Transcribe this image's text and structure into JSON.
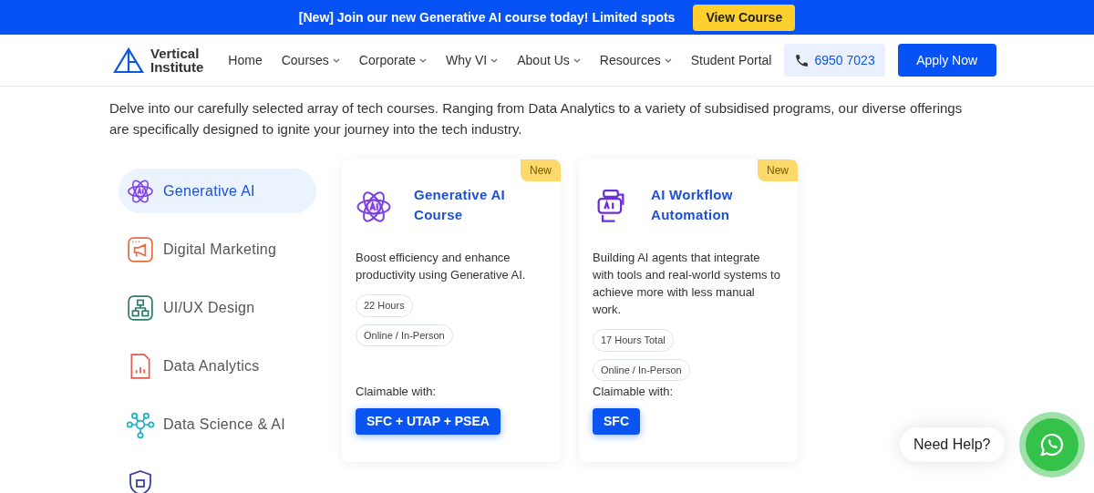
{
  "banner": {
    "text": "[New] Join our new Generative AI course today! Limited spots",
    "button": "View Course"
  },
  "nav": {
    "logo": [
      "Vertical",
      "Institute"
    ],
    "items": [
      {
        "label": "Home",
        "dropdown": false
      },
      {
        "label": "Courses",
        "dropdown": true
      },
      {
        "label": "Corporate",
        "dropdown": true
      },
      {
        "label": "Why VI",
        "dropdown": true
      },
      {
        "label": "About Us",
        "dropdown": true
      },
      {
        "label": "Resources",
        "dropdown": true
      },
      {
        "label": "Student Portal",
        "dropdown": false
      }
    ],
    "phone": "6950 7023",
    "cta": "Apply Now"
  },
  "intro": "Delve into our carefully selected array of tech courses. Ranging from Data Analytics to a variety of subsidised programs, our diverse offerings are specifically designed to ignite your journey into the tech industry.",
  "sidebar": {
    "items": [
      {
        "label": "Generative AI",
        "kind": "ai",
        "selected": true
      },
      {
        "label": "Digital Marketing",
        "kind": "marketing",
        "selected": false
      },
      {
        "label": "UI/UX Design",
        "kind": "design",
        "selected": false
      },
      {
        "label": "Data Analytics",
        "kind": "analytics",
        "selected": false
      },
      {
        "label": "Data Science & AI",
        "kind": "science",
        "selected": false
      }
    ]
  },
  "cards": [
    {
      "badge": "New",
      "kind": "ai",
      "title": "Generative AI Course",
      "description": "Boost efficiency and enhance productivity using Generative AI.",
      "tags": [
        "22 Hours",
        "Online / In-Person"
      ],
      "claim_label": "Claimable with:",
      "claim": "SFC + UTAP + PSEA"
    },
    {
      "badge": "New",
      "kind": "workflow",
      "title": "AI Workflow Automation",
      "description": "Building AI agents that integrate with tools and real-world systems to achieve more with less manual work.",
      "tags": [
        "17 Hours Total",
        "Online / In-Person"
      ],
      "claim_label": "Claimable with:",
      "claim": "SFC"
    }
  ],
  "help": {
    "label": "Need Help?"
  }
}
